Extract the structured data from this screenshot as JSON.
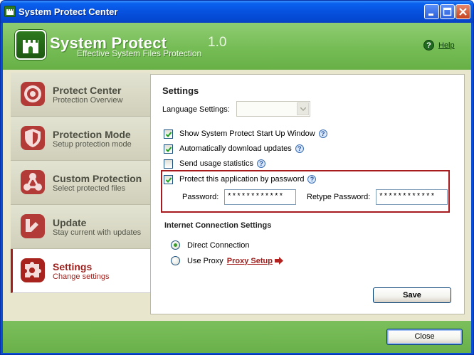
{
  "window": {
    "title": "System Protect Center"
  },
  "header": {
    "brand_name": "System Protect",
    "brand_version": "1.0",
    "tagline": "Effective System Files Protection",
    "help_label": "Help"
  },
  "sidebar": {
    "items": [
      {
        "title": "Protect Center",
        "subtitle": "Protection Overview",
        "icon": "target-icon",
        "active": false
      },
      {
        "title": "Protection Mode",
        "subtitle": "Setup protection mode",
        "icon": "shield-icon",
        "active": false
      },
      {
        "title": "Custom Protection",
        "subtitle": "Select protected files",
        "icon": "molecule-icon",
        "active": false
      },
      {
        "title": "Update",
        "subtitle": "Stay current with updates",
        "icon": "update-arrow-icon",
        "active": false
      },
      {
        "title": "Settings",
        "subtitle": "Change settings",
        "icon": "puzzle-icon",
        "active": true
      }
    ]
  },
  "settings": {
    "heading": "Settings",
    "language_label": "Language Settings:",
    "language_value": "",
    "options": [
      {
        "label": "Show System Protect Start Up Window",
        "checked": true
      },
      {
        "label": "Automatically download updates",
        "checked": true
      },
      {
        "label": "Send usage statistics",
        "checked": false
      },
      {
        "label": "Protect this application by password",
        "checked": true
      }
    ],
    "password_label": "Password:",
    "password_value": "************",
    "retype_label": "Retype Password:",
    "retype_value": "************",
    "internet_heading": "Internet Connection Settings",
    "direct_label": "Direct Connection",
    "proxy_label": "Use Proxy",
    "proxy_setup_label": "Proxy Setup",
    "connection_mode": "direct",
    "save_label": "Save"
  },
  "footer": {
    "close_label": "Close"
  },
  "colors": {
    "accent_red": "#9e1f1b",
    "header_green": "#75bc55",
    "title_blue": "#0753e0"
  }
}
